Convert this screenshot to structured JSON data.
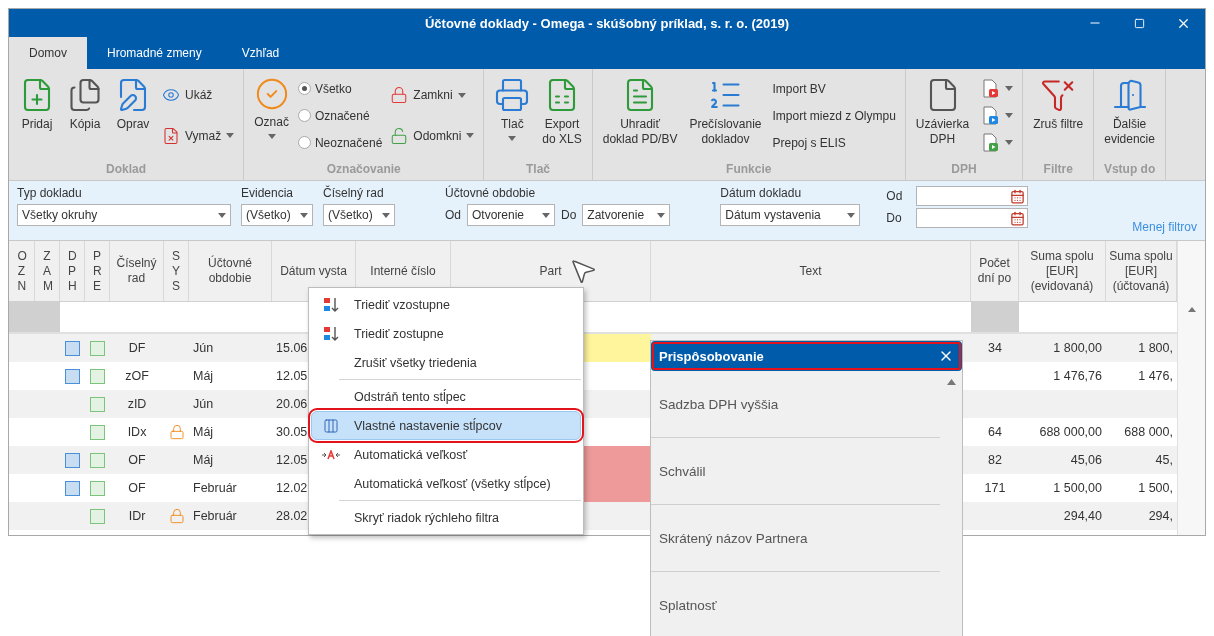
{
  "window": {
    "title": "Účtovné doklady - Omega - skúšobný príklad, s. r. o.  (2019)"
  },
  "tabs": [
    {
      "label": "Domov",
      "selected": true
    },
    {
      "label": "Hromadné zmeny",
      "selected": false
    },
    {
      "label": "Vzhľad",
      "selected": false
    }
  ],
  "ribbon": {
    "groups": [
      {
        "label": "Doklad",
        "columns": [
          [
            {
              "kind": "large",
              "label": "Pridaj",
              "dropdown": false
            }
          ],
          [
            {
              "kind": "large",
              "label": "Kópia",
              "dropdown": false
            }
          ],
          [
            {
              "kind": "large",
              "label": "Oprav",
              "dropdown": false
            }
          ],
          [
            {
              "kind": "small",
              "label": "Ukáž",
              "dropdown": false
            },
            {
              "kind": "small",
              "label": "Vymaž",
              "dropdown": true
            }
          ]
        ]
      },
      {
        "label": "Označovanie",
        "columns": [
          [
            {
              "kind": "large",
              "label": "Označ",
              "dropdown": true
            }
          ],
          [
            {
              "kind": "radio",
              "label": "Všetko",
              "selected": true
            },
            {
              "kind": "radio",
              "label": "Označené",
              "selected": false
            },
            {
              "kind": "radio",
              "label": "Neoznačené",
              "selected": false
            }
          ],
          [
            {
              "kind": "small",
              "label": "Zamkni",
              "dropdown": true
            },
            {
              "kind": "small",
              "label": "Odomkni",
              "dropdown": true
            }
          ]
        ]
      },
      {
        "label": "Tlač",
        "columns": [
          [
            {
              "kind": "large",
              "label": "Tlač",
              "dropdown": true
            }
          ],
          [
            {
              "kind": "large",
              "label": "Export\ndo XLS",
              "dropdown": false
            }
          ]
        ]
      },
      {
        "label": "Funkcie",
        "columns": [
          [
            {
              "kind": "large",
              "label": "Uhradiť\ndoklad PD/BV",
              "dropdown": false
            }
          ],
          [
            {
              "kind": "large",
              "label": "Prečíslovanie\ndokladov",
              "dropdown": false
            }
          ],
          [
            {
              "kind": "text",
              "label": "Import BV"
            },
            {
              "kind": "text",
              "label": "Import miezd z Olympu"
            },
            {
              "kind": "text",
              "label": "Prepoj s ELIS"
            }
          ]
        ]
      },
      {
        "label": "DPH",
        "columns": [
          [
            {
              "kind": "large",
              "label": "Uzávierka\nDPH",
              "dropdown": false
            }
          ],
          [
            {
              "kind": "icon",
              "dropdown": true
            },
            {
              "kind": "icon",
              "dropdown": true
            },
            {
              "kind": "icon",
              "dropdown": true
            }
          ]
        ]
      },
      {
        "label": "Filtre",
        "columns": [
          [
            {
              "kind": "large",
              "label": "Zruš filtre",
              "dropdown": false
            }
          ]
        ]
      },
      {
        "label": "Vstup do",
        "columns": [
          [
            {
              "kind": "large",
              "label": "Ďalšie\nevidencie",
              "dropdown": false
            }
          ]
        ]
      }
    ]
  },
  "filters": {
    "document_type": {
      "label": "Typ dokladu",
      "value": "Všetky okruhy"
    },
    "evidence": {
      "label": "Evidencia",
      "value": "(Všetko)"
    },
    "series": {
      "label": "Číselný rad",
      "value": "(Všetko)"
    },
    "period": {
      "label": "Účtovné obdobie",
      "from_label": "Od",
      "from": "Otvorenie",
      "to_label": "Do",
      "to": "Zatvorenie"
    },
    "document_date": {
      "label": "Dátum dokladu",
      "value": "Dátum vystavenia",
      "from_label": "Od",
      "to_label": "Do"
    },
    "toggle_link": "Menej filtrov"
  },
  "grid": {
    "columns": [
      {
        "label": "OZN",
        "filter_disabled": true
      },
      {
        "label": "ZAM",
        "filter_disabled": true
      },
      {
        "label": "DPH"
      },
      {
        "label": "PRE"
      },
      {
        "label": "Číselný rad"
      },
      {
        "label": "SYS"
      },
      {
        "label": "Účtovné obdobie"
      },
      {
        "label": "Dátum vysta"
      },
      {
        "label": "Interné číslo"
      },
      {
        "label": "Part"
      },
      {
        "label": "Text"
      },
      {
        "label": "Počet dní po",
        "filter_disabled": true
      },
      {
        "label": "Suma spolu [EUR] (evidovaná)"
      },
      {
        "label": "Suma spolu [EUR] (účtovaná)"
      }
    ],
    "rows": [
      {
        "dph": true,
        "pre": true,
        "series": "DF",
        "locked": false,
        "period": "Jún",
        "date": "15.06",
        "color": "#fff59d",
        "days": "34",
        "sum_evid": "1 800,00",
        "sum_acc": "1 800,"
      },
      {
        "dph": true,
        "pre": true,
        "series": "zOF",
        "locked": false,
        "period": "Máj",
        "date": "12.05",
        "sum_evid": "1 476,76",
        "sum_acc": "1 476,"
      },
      {
        "dph": false,
        "pre": true,
        "series": "zID",
        "locked": false,
        "period": "Jún",
        "date": "20.06"
      },
      {
        "dph": false,
        "pre": true,
        "series": "IDx",
        "locked": true,
        "period": "Máj",
        "date": "30.05",
        "days": "64",
        "sum_evid": "688 000,00",
        "sum_acc": "688 000,"
      },
      {
        "dph": true,
        "pre": true,
        "series": "OF",
        "locked": false,
        "period": "Máj",
        "date": "12.05",
        "color": "#ef9a9a",
        "days": "82",
        "sum_evid": "45,06",
        "sum_acc": "45,"
      },
      {
        "dph": true,
        "pre": true,
        "series": "OF",
        "locked": false,
        "period": "Február",
        "date": "12.02",
        "color": "#ef9a9a",
        "days": "171",
        "sum_evid": "1 500,00",
        "sum_acc": "1 500,"
      },
      {
        "dph": false,
        "pre": true,
        "series": "IDr",
        "locked": true,
        "period": "Február",
        "date": "28.02",
        "sum_evid": "294,40",
        "sum_acc": "294,"
      }
    ]
  },
  "context_menu": {
    "items": [
      {
        "label": "Triediť vzostupne",
        "separator_before": false,
        "selected": false
      },
      {
        "label": "Triediť zostupne",
        "separator_before": false,
        "selected": false
      },
      {
        "label": "Zrušiť všetky triedenia",
        "separator_before": false,
        "selected": false
      },
      {
        "label": "Odstráň tento stĺpec",
        "separator_before": true,
        "selected": false
      },
      {
        "label": "Vlastné nastavenie stĺpcov",
        "separator_before": false,
        "selected": true
      },
      {
        "label": "Automatická veľkosť",
        "separator_before": false,
        "selected": false
      },
      {
        "label": "Automatická veľkosť (všetky stĺpce)",
        "separator_before": false,
        "selected": false
      },
      {
        "label": "Skryť riadok rýchleho filtra",
        "separator_before": true,
        "selected": false
      }
    ]
  },
  "customization_panel": {
    "title": "Prispôsobovanie",
    "items": [
      "Sadzba DPH vyššia",
      "Schválil",
      "Skrátený názov Partnera",
      "Splatnosť"
    ]
  }
}
